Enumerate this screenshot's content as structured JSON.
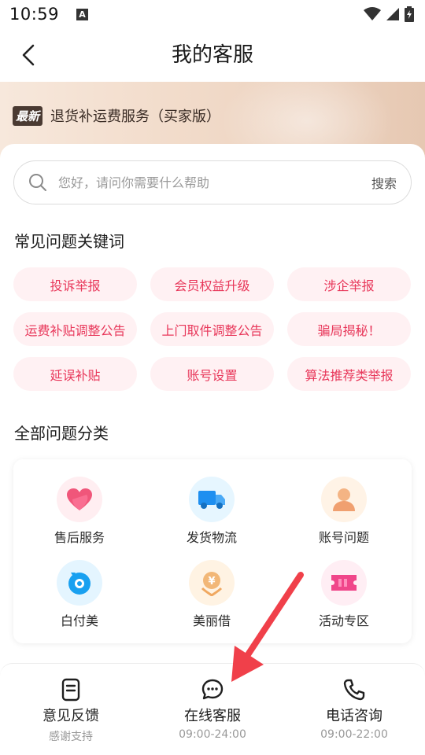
{
  "status_bar": {
    "time": "10:59",
    "notif_letter": "A"
  },
  "nav": {
    "title": "我的客服"
  },
  "banner": {
    "badge": "最新",
    "text": "退货补运费服务（买家版）"
  },
  "search": {
    "placeholder": "您好，请问你需要什么帮助",
    "button": "搜索"
  },
  "keywords": {
    "title": "常见问题关键词",
    "items": [
      "投诉举报",
      "会员权益升级",
      "涉企举报",
      "运费补贴调整公告",
      "上门取件调整公告",
      "骗局揭秘！",
      "延误补贴",
      "账号设置",
      "算法推荐类举报"
    ]
  },
  "categories": {
    "title": "全部问题分类",
    "items": [
      {
        "label": "售后服务",
        "icon": "heart-icon"
      },
      {
        "label": "发货物流",
        "icon": "truck-icon"
      },
      {
        "label": "账号问题",
        "icon": "user-icon"
      },
      {
        "label": "白付美",
        "icon": "wallet-icon"
      },
      {
        "label": "美丽借",
        "icon": "yen-icon"
      },
      {
        "label": "活动专区",
        "icon": "ticket-icon"
      }
    ]
  },
  "bottom_bar": {
    "items": [
      {
        "label": "意见反馈",
        "sub": "感谢支持",
        "icon": "feedback-icon"
      },
      {
        "label": "在线客服",
        "sub": "09:00-24:00",
        "icon": "chat-icon"
      },
      {
        "label": "电话咨询",
        "sub": "09:00-22:00",
        "icon": "phone-icon"
      }
    ]
  },
  "colors": {
    "accent": "#e8375a",
    "keyword_bg": "#fff1f3",
    "arrow": "#f0404a"
  }
}
